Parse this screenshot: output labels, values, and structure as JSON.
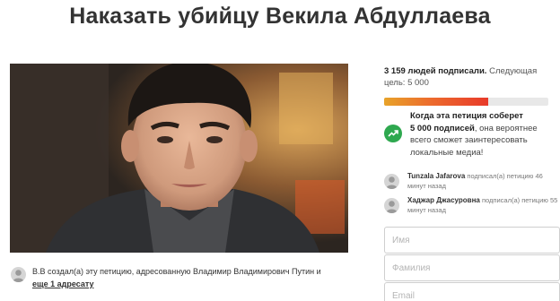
{
  "petition": {
    "title": "Наказать убийцу Векила Абдуллаева"
  },
  "creator": {
    "name": "В.В",
    "text": " создал(а) эту петицию, адресованную Владимир Владимирович Путин и",
    "more_link": "еще 1 адресату"
  },
  "progress": {
    "count_bold": "3 159 людей подписали.",
    "count_rest": " Следующая цель: 5 000",
    "fraction": 0.632
  },
  "goal": {
    "line1": "Когда эта петиция соберет",
    "line2_bold": "5 000 подписей",
    "line2_rest": ", она вероятнее всего сможет заинтересовать локальные медиа!"
  },
  "signers": [
    {
      "name": "Tunzala Jafarova",
      "action": " подписал(а) петицию 46 минут назад"
    },
    {
      "name": "Хаджар Джасуровна",
      "action": " подписал(а) петицию 55 минут назад"
    }
  ],
  "form": {
    "first_name_placeholder": "Имя",
    "last_name_placeholder": "Фамилия",
    "email_placeholder": "Email"
  },
  "colors": {
    "progress_fill": "#ec6b2d",
    "goal_badge": "#2ea84f"
  },
  "icons": {
    "goal": "trending-up-icon",
    "avatar": "user-avatar-icon"
  }
}
